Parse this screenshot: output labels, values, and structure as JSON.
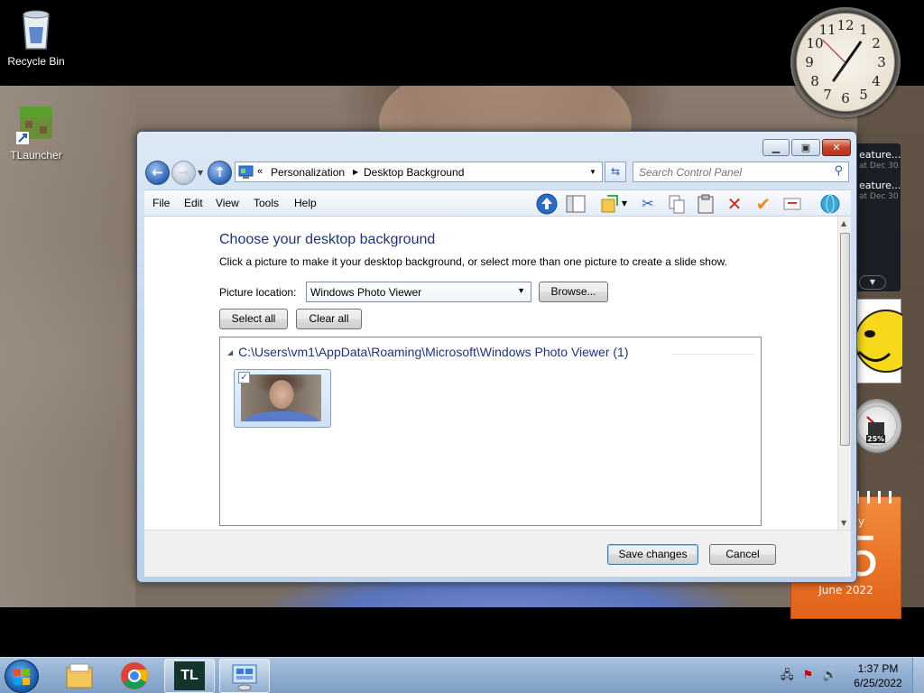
{
  "desktop": {
    "icons": [
      {
        "label": "Recycle Bin",
        "icon": "recycle-bin-icon"
      },
      {
        "label": "TLauncher",
        "icon": "tlauncher-icon"
      }
    ]
  },
  "gadgets": {
    "clock_numbers": [
      "12",
      "1",
      "2",
      "3",
      "4",
      "5",
      "6",
      "7",
      "8",
      "9",
      "10",
      "11"
    ],
    "feeds": [
      {
        "title": "eature...",
        "date": "at Dec 30"
      },
      {
        "title": "eature...",
        "date": "at Dec 30"
      }
    ],
    "meter_value": "25%",
    "calendar": {
      "day": "ay",
      "date": "25",
      "month": "June 2022"
    }
  },
  "window": {
    "breadcrumb": [
      "Personalization",
      "Desktop Background"
    ],
    "breadcrumb_prefix": "«",
    "search_placeholder": "Search Control Panel",
    "menu": [
      "File",
      "Edit",
      "View",
      "Tools",
      "Help"
    ],
    "heading": "Choose your desktop background",
    "description": "Click a picture to make it your desktop background, or select more than one picture to create a slide show.",
    "picture_location_label": "Picture location:",
    "picture_location_value": "Windows Photo Viewer",
    "browse_label": "Browse...",
    "select_all_label": "Select all",
    "clear_all_label": "Clear all",
    "group_title": "C:\\Users\\vm1\\AppData\\Roaming\\Microsoft\\Windows Photo Viewer (1)",
    "thumbnail_checked": true,
    "save_label": "Save changes",
    "cancel_label": "Cancel"
  },
  "taskbar": {
    "time": "1:37 PM",
    "date": "6/25/2022",
    "apps": [
      "windows-explorer-icon",
      "chrome-icon",
      "tlauncher-icon",
      "control-panel-icon"
    ],
    "tl_text": "TL"
  },
  "colors": {
    "heading_blue": "#1e3287",
    "calendar_orange": "#e2621a",
    "taskbar_blue": "#92b0d4"
  }
}
